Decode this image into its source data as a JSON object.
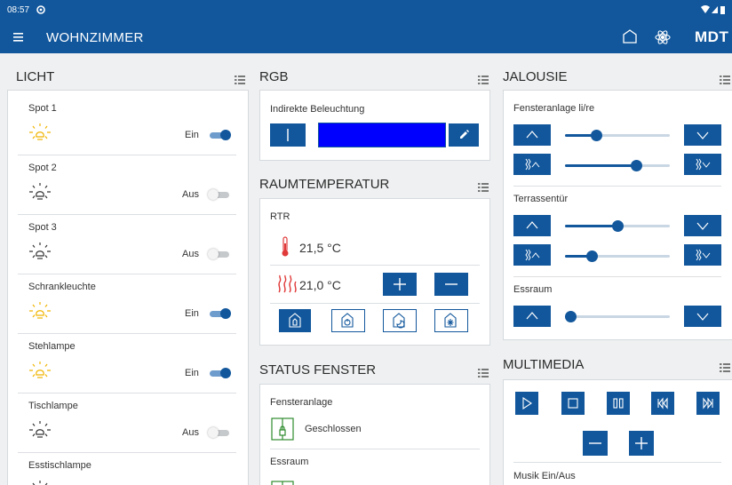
{
  "status_bar": {
    "time": "08:57",
    "sys_icons": "wifi-icon signal-icon battery-icon"
  },
  "app_bar": {
    "title": "WOHNZIMMER",
    "logo": "MDT"
  },
  "licht": {
    "title": "LICHT",
    "items": [
      {
        "label": "Spot 1",
        "state": "Ein",
        "on": true
      },
      {
        "label": "Spot 2",
        "state": "Aus",
        "on": false
      },
      {
        "label": "Spot 3",
        "state": "Aus",
        "on": false
      },
      {
        "label": "Schrankleuchte",
        "state": "Ein",
        "on": true
      },
      {
        "label": "Stehlampe",
        "state": "Ein",
        "on": true
      },
      {
        "label": "Tischlampe",
        "state": "Aus",
        "on": false
      },
      {
        "label": "Esstischlampe",
        "state": "",
        "on": false
      }
    ]
  },
  "rgb": {
    "title": "RGB",
    "label": "Indirekte Beleuchtung",
    "color": "#0000ff"
  },
  "raumtemperatur": {
    "title": "RAUMTEMPERATUR",
    "label": "RTR",
    "actual": "21,5 °C",
    "setpoint": "21,0 °C"
  },
  "status_fenster": {
    "title": "STATUS FENSTER",
    "items": [
      {
        "label": "Fensteranlage",
        "state": "Geschlossen"
      },
      {
        "label": "Essraum",
        "state": ""
      }
    ]
  },
  "jalousie": {
    "title": "JALOUSIE",
    "groups": [
      {
        "label": "Fensteranlage li/re",
        "position": 0.3,
        "slat": 0.68
      },
      {
        "label": "Terrassentür",
        "position": 0.5,
        "slat": 0.25
      },
      {
        "label": "Essraum",
        "position": 0.03
      }
    ]
  },
  "multimedia": {
    "title": "MULTIMEDIA",
    "label": "Musik Ein/Aus"
  },
  "colors": {
    "primary": "#12579c",
    "bulb_on": "#f0b400",
    "heat": "#e03a3a"
  }
}
